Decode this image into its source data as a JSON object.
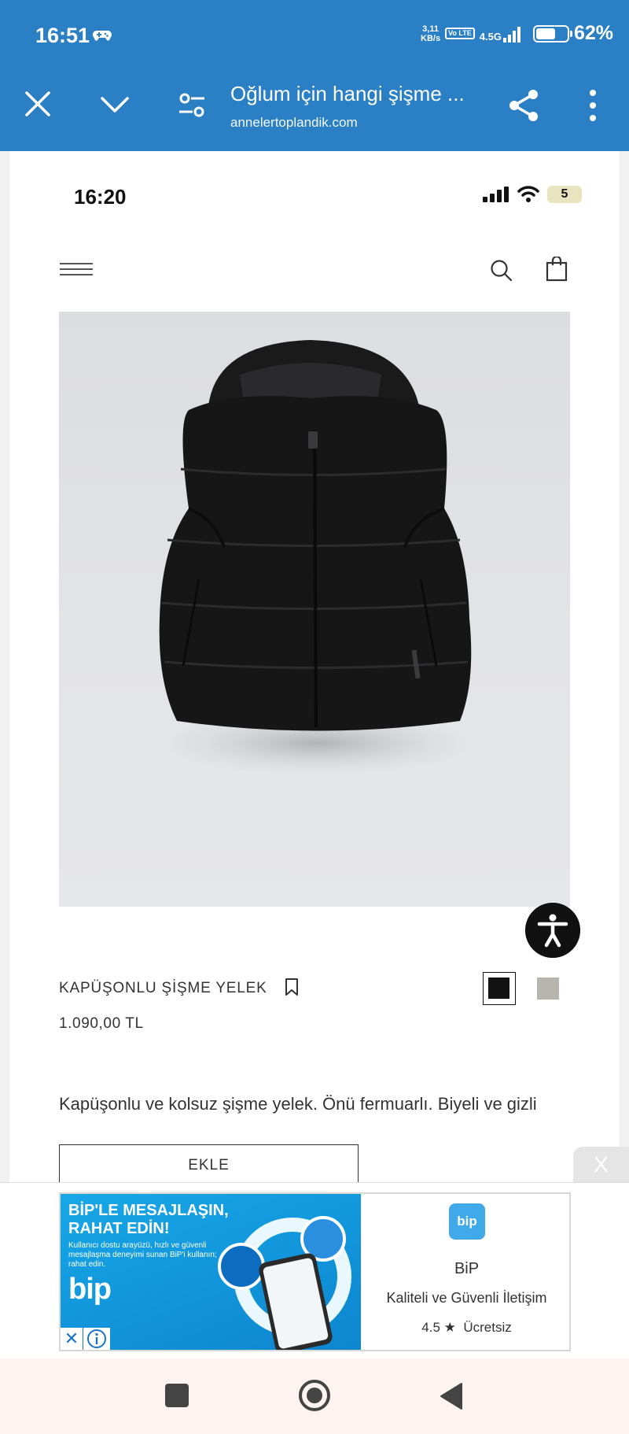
{
  "status_bar": {
    "time": "16:51",
    "speed": "3,11",
    "speed_unit": "KB/s",
    "volte": "Vo LTE",
    "network": "4.5G",
    "battery_percent": "62%",
    "battery_level": 0.62
  },
  "browser": {
    "title": "Oğlum için hangi şişme ...",
    "url": "annelertoplandik.com"
  },
  "inner_screen": {
    "time": "16:20",
    "battery": "5"
  },
  "product": {
    "name": "KAPÜŞONLU ŞİŞME YELEK",
    "price": "1.090,00 TL",
    "description": "Kapüşonlu ve kolsuz şişme yelek. Önü fermuarlı. Biyeli ve gizli",
    "add_label": "EKLE",
    "swatches": [
      {
        "color": "#121212",
        "selected": true
      },
      {
        "color": "#b6b5ad",
        "selected": false
      }
    ]
  },
  "ad": {
    "close_label": "X",
    "headline": "BİP'LE MESAJLAŞIN, RAHAT EDİN!",
    "subtext": "Kullanıcı dostu arayüzü, hızlı ve güvenli mesajlaşma deneyimi sunan BiP'i kullanın; rahat edin.",
    "banner_logo": "bip",
    "app_logo": "bip",
    "app_name": "BiP",
    "tagline": "Kaliteli ve Güvenli İletişim",
    "rating": "4.5 ★",
    "price": "Ücretsiz",
    "badge_close": "✕"
  }
}
